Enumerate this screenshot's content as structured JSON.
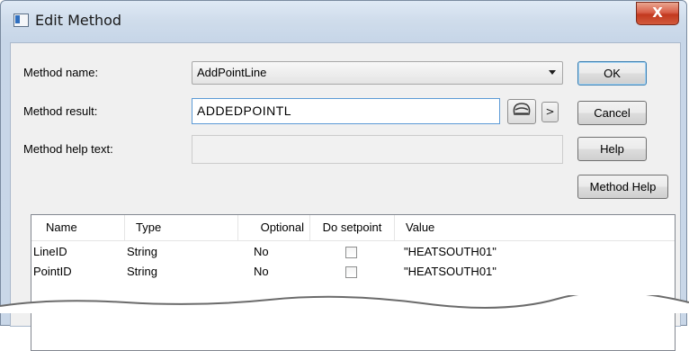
{
  "window": {
    "title": "Edit Method",
    "close_glyph": "X"
  },
  "form": {
    "method_name_label": "Method name:",
    "method_name_value": "AddPointLine",
    "method_result_label": "Method result:",
    "method_result_value": "ADDEDPOINTL",
    "method_help_text_label": "Method help text:",
    "method_help_text_value": "",
    "expand_button_glyph": ">",
    "expression_icon": "expression-editor-icon"
  },
  "buttons": {
    "ok": "OK",
    "cancel": "Cancel",
    "help": "Help",
    "method_help": "Method Help"
  },
  "grid": {
    "columns": [
      "Name",
      "Type",
      "Optional",
      "Do setpoint",
      "Value"
    ],
    "rows": [
      {
        "name": "LineID",
        "type": "String",
        "optional": "No",
        "do_setpoint": false,
        "value": "\"HEATSOUTH01\""
      },
      {
        "name": "PointID",
        "type": "String",
        "optional": "No",
        "do_setpoint": false,
        "value": "\"HEATSOUTH01\""
      }
    ]
  }
}
